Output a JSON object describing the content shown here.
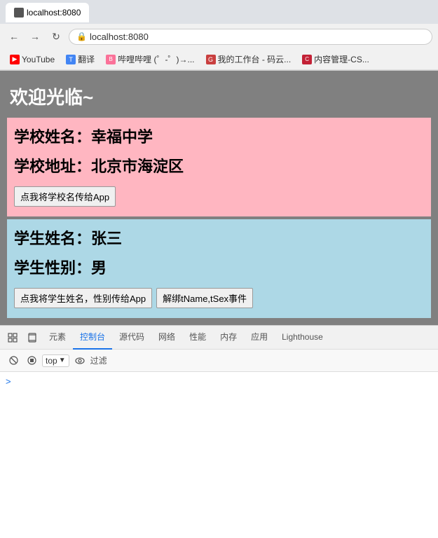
{
  "browser": {
    "url": "localhost:8080",
    "back_label": "←",
    "forward_label": "→",
    "reload_label": "↻",
    "tab_title": "localhost:8080",
    "bookmarks": [
      {
        "label": "YouTube",
        "color": "fav-youtube",
        "char": "▶"
      },
      {
        "label": "翻译",
        "color": "fav-translate",
        "char": "T"
      },
      {
        "label": "哔哩哔哩 (゜-゜)→...",
        "color": "fav-bilibili",
        "char": "B"
      },
      {
        "label": "我的工作台 - 码云...",
        "color": "fav-g",
        "char": "G"
      },
      {
        "label": "内容管理-CS...",
        "color": "fav-csdn",
        "char": "C"
      }
    ]
  },
  "page": {
    "welcome": "欢迎光临~",
    "school": {
      "name_label": "学校姓名：幸福中学",
      "address_label": "学校地址：北京市海淀区",
      "btn_label": "点我将学校名传给App"
    },
    "student": {
      "name_label": "学生姓名：张三",
      "gender_label": "学生性别：男",
      "btn1_label": "点我将学生姓名，性别传给App",
      "btn2_label": "解绑tName,tSex事件"
    }
  },
  "devtools": {
    "tabs": [
      "元素",
      "控制台",
      "源代码",
      "网络",
      "性能",
      "内存",
      "应用",
      "Lighthouse"
    ],
    "active_tab": "控制台",
    "top_label": "top",
    "filter_placeholder": "过滤",
    "console_prompt": ">"
  }
}
